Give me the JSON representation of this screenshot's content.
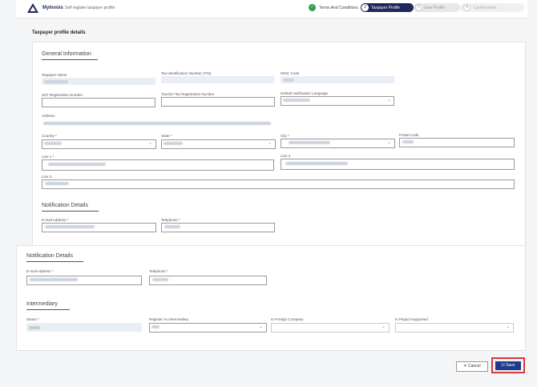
{
  "app": {
    "brand": "MyInvois",
    "subtitle": "Self register taxpayer profile"
  },
  "steps": [
    {
      "num": "✓",
      "label": "Terms And Conditions",
      "state": "done"
    },
    {
      "num": "2",
      "label": "Taxpayer Profile",
      "state": "active"
    },
    {
      "num": "3",
      "label": "User Profile",
      "state": "pending"
    },
    {
      "num": "4",
      "label": "Confirmation",
      "state": "pending"
    }
  ],
  "page_title": "Taxpayer profile details",
  "general": {
    "title": "General Information",
    "taxpayer_name_label": "Taxpayer Name",
    "tin_label": "Tax Identification Number (TIN)",
    "msic_label": "MSIC Code",
    "sst_label": "SST Registration Number",
    "tourism_label": "Tourism Tax Registration Number",
    "language_label": "Default Notification Language",
    "address_label": "Address",
    "country_label": "Country *",
    "state_label": "State *",
    "city_label": "City *",
    "postal_label": "Postal Code",
    "line1_label": "Line 1 *",
    "line2_label": "Line 2",
    "line3_label": "Line 3"
  },
  "notification": {
    "title": "Notification Details",
    "email_label": "E-mail Address *",
    "telephone_label": "Telephone *"
  },
  "notification2": {
    "title": "Notification Details",
    "email_label": "E-mail Address *",
    "telephone_label": "Telephone *"
  },
  "intermediary": {
    "title": "Intermediary",
    "status_label": "Status *",
    "register_label": "Register As Intermediary",
    "foreign_label": "Is Foreign Company",
    "peppol_label": "Is Peppol Supported"
  },
  "buttons": {
    "cancel": "✕ Cancel",
    "save": "☑ Save"
  },
  "colors": {
    "accent": "#1e3a8a",
    "highlight": "#d9363e",
    "done": "#2e9e4f"
  }
}
